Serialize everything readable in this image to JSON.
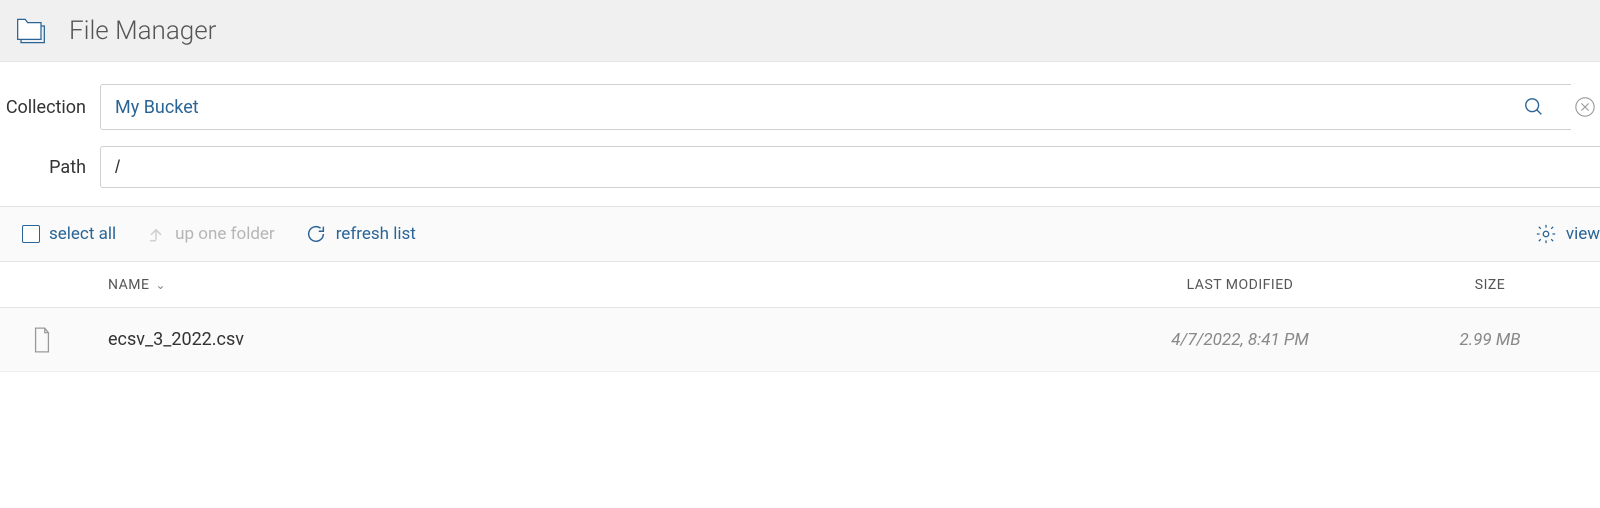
{
  "header": {
    "title": "File Manager"
  },
  "fields": {
    "collection_label": "Collection",
    "collection_value": "My Bucket",
    "path_label": "Path",
    "path_value": "/"
  },
  "toolbar": {
    "select_all": "select all",
    "up_one_folder": "up one folder",
    "refresh_list": "refresh list",
    "view": "view"
  },
  "table": {
    "columns": {
      "name": "NAME",
      "last_modified": "LAST MODIFIED",
      "size": "SIZE"
    },
    "rows": [
      {
        "name": "ecsv_3_2022.csv",
        "last_modified": "4/7/2022, 8:41 PM",
        "size": "2.99 MB"
      }
    ]
  }
}
